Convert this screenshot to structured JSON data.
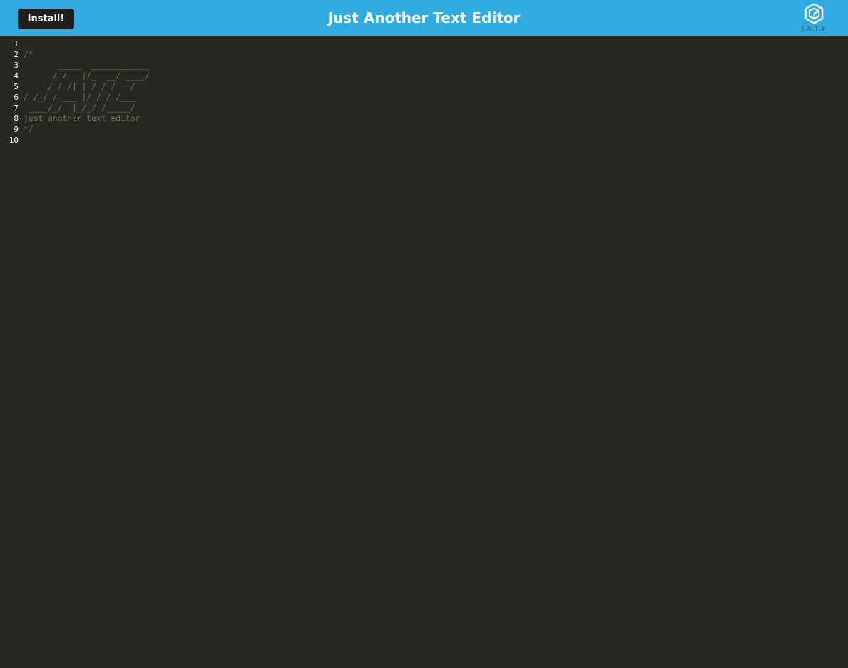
{
  "header": {
    "install_label": "Install!",
    "title": "Just Another Text Editor",
    "logo_text": "J.A.T.E",
    "logo_icon": "jate-logo-icon"
  },
  "editor": {
    "line_numbers": [
      "1",
      "2",
      "3",
      "4",
      "5",
      "6",
      "7",
      "8",
      "9",
      "10"
    ],
    "lines": [
      "",
      "/*",
      "       _____  ____________",
      "      / /   |/_  __/ ____/",
      " __  / / /| | / / / __/",
      "/ /_/ / ___ |/ / / /___",
      " ____/_/  |_/_/ /_____/",
      "just another text editor",
      "*/",
      ""
    ]
  },
  "colors": {
    "navbar": "#31a9e1",
    "editor_background": "#272822",
    "comment": "#75715e",
    "line_number": "#f8f8f2"
  }
}
